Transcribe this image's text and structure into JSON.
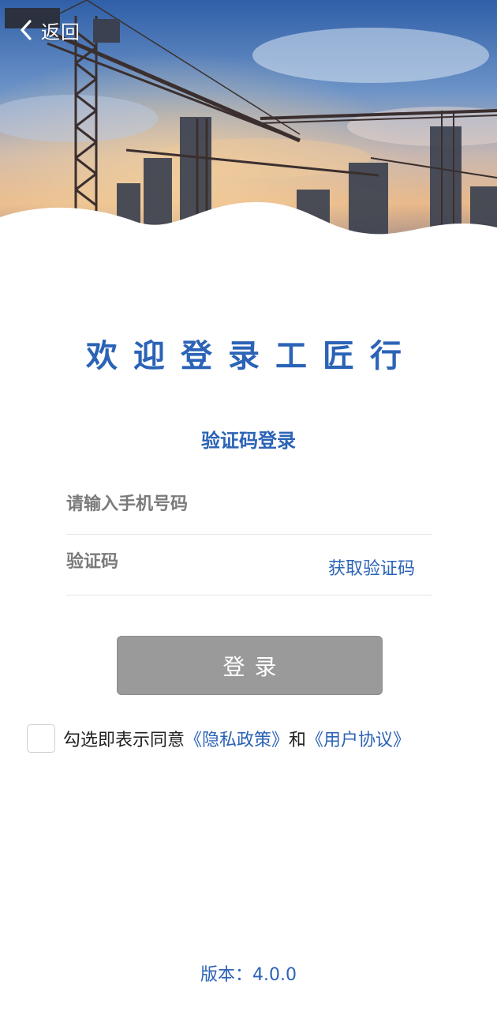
{
  "header": {
    "back_label": "返回"
  },
  "welcome_title": "欢迎登录工匠行",
  "login_mode_title": "验证码登录",
  "form": {
    "phone_placeholder": "请输入手机号码",
    "phone_value": "",
    "code_placeholder": "验证码",
    "code_value": "",
    "get_code_label": "获取验证码",
    "login_label": "登录"
  },
  "agreement": {
    "checked": false,
    "prefix": "勾选即表示同意",
    "privacy_link": "《隐私政策》",
    "and": "和",
    "user_agreement_link": "《用户协议》"
  },
  "version_text": "版本：4.0.0",
  "colors": {
    "accent": "#2b63b6",
    "button_disabled": "#9a9a9a"
  },
  "icons": {
    "back": "chevron-left-icon",
    "hero": "construction-cranes-banner"
  }
}
